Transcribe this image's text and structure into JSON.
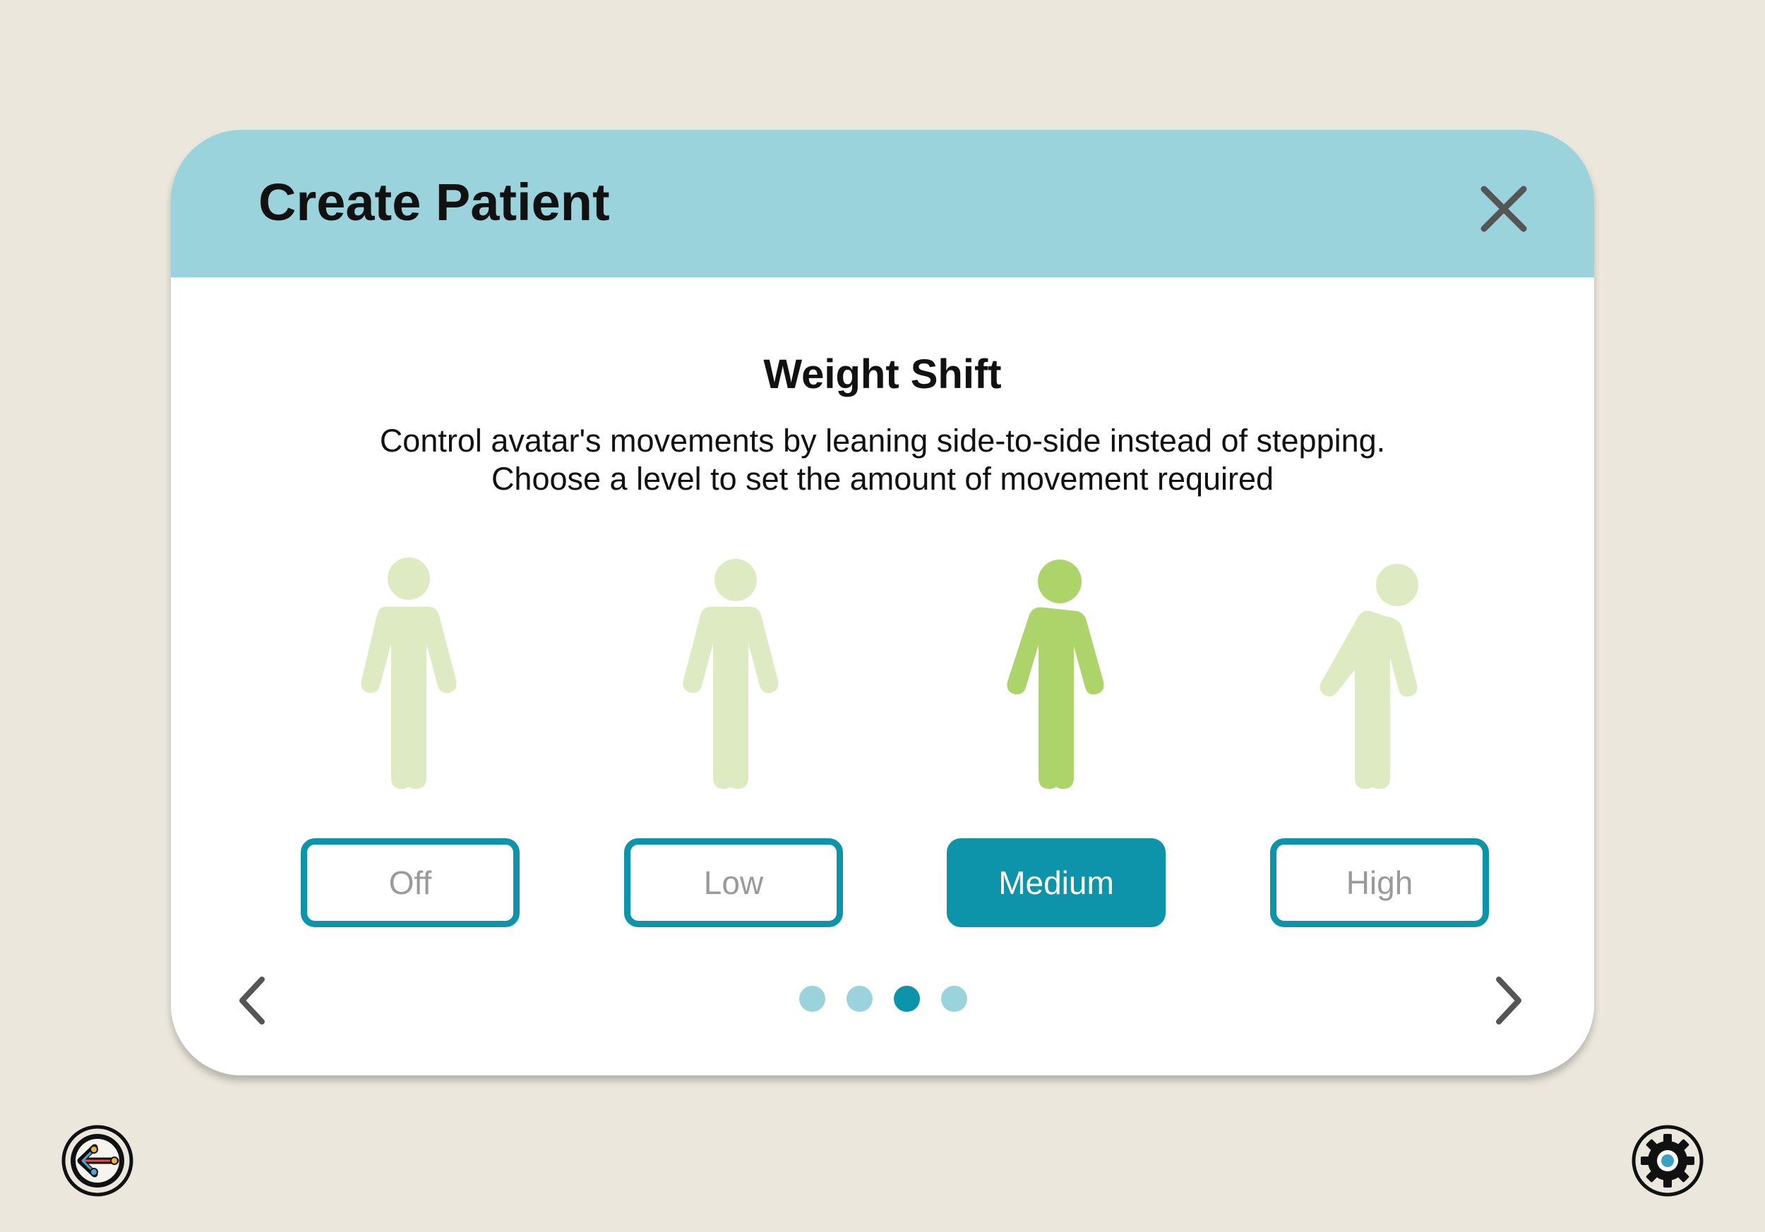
{
  "modal": {
    "title": "Create Patient",
    "close_icon": "close-icon"
  },
  "section": {
    "title": "Weight Shift",
    "description_line1": "Control avatar's movements by leaning side-to-side instead of stepping.",
    "description_line2": "Choose a level to set the amount of movement required"
  },
  "levels": [
    {
      "label": "Off",
      "selected": false,
      "icon": "standing-person-icon"
    },
    {
      "label": "Low",
      "selected": false,
      "icon": "standing-person-icon"
    },
    {
      "label": "Medium",
      "selected": true,
      "icon": "leaning-person-icon"
    },
    {
      "label": "High",
      "selected": false,
      "icon": "leaning-person-icon"
    }
  ],
  "pagination": {
    "total_pages": 4,
    "current_page": 3
  },
  "navigation": {
    "prev_icon": "chevron-left-icon",
    "next_icon": "chevron-right-icon",
    "back_icon": "back-arrow-icon",
    "settings_icon": "gear-icon"
  },
  "colors": {
    "background": "#ebe7dc",
    "header": "#9bd3dd",
    "accent": "#0d93aa",
    "figure_active": "#acd46a",
    "figure_inactive": "#deebc2",
    "dot_inactive": "#9bd3dd"
  }
}
